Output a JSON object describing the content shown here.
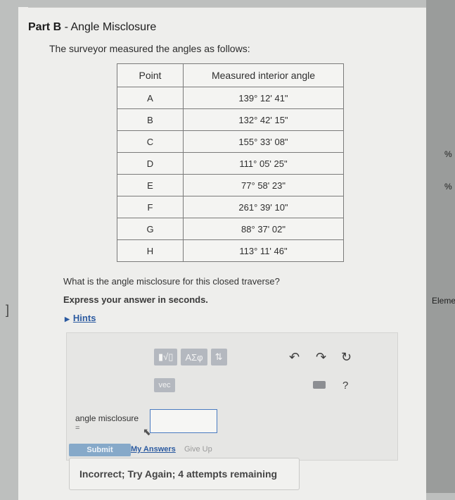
{
  "part_title_bold": "Part B",
  "part_title_rest": " - Angle Misclosure",
  "intro": "The surveyor measured the angles as follows:",
  "table": {
    "headers": [
      "Point",
      "Measured interior angle"
    ],
    "rows": [
      [
        "A",
        "139° 12' 41\""
      ],
      [
        "B",
        "132° 42' 15\""
      ],
      [
        "C",
        "155° 33' 08\""
      ],
      [
        "D",
        "111° 05' 25\""
      ],
      [
        "E",
        "77° 58' 23\""
      ],
      [
        "F",
        "261° 39' 10\""
      ],
      [
        "G",
        "88° 37' 02\""
      ],
      [
        "H",
        "113° 11' 46\""
      ]
    ]
  },
  "question": "What is the angle misclosure for this closed traverse?",
  "instruction": "Express your answer in seconds.",
  "hints_label": "Hints",
  "toolbar": {
    "templates_label": "▮√▯",
    "greek_label": "ΑΣφ",
    "arrows_label": "⇅",
    "vec_label": "vec",
    "help_label": "?"
  },
  "field": {
    "label": "angle misclosure",
    "equals": "=",
    "value": ""
  },
  "actions": {
    "submit": "Submit",
    "my_answers": "My Answers",
    "give_up": "Give Up"
  },
  "feedback": "Incorrect; Try Again; 4 attempts remaining",
  "right_panel": {
    "pct1": "%",
    "pct2": "%",
    "eleme": "Eleme"
  }
}
